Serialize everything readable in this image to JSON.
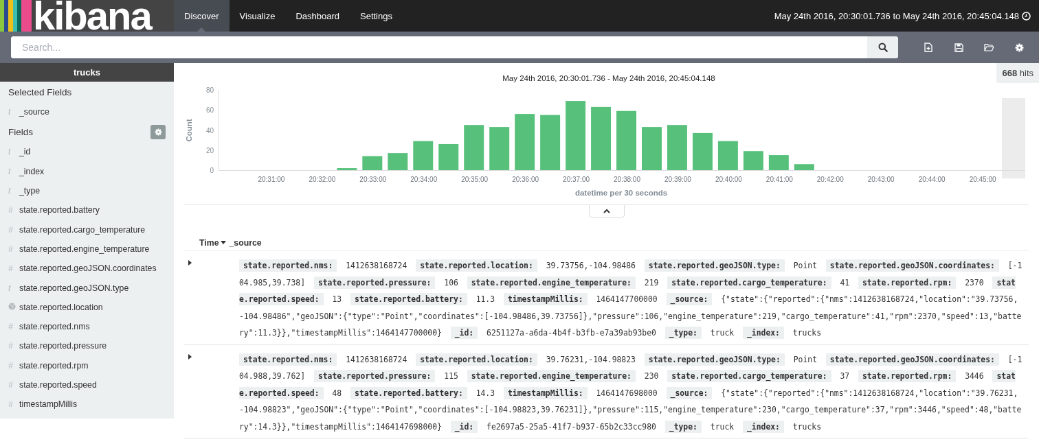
{
  "header": {
    "logo": "kibana",
    "nav": [
      {
        "label": "Discover",
        "selected": true
      },
      {
        "label": "Visualize",
        "selected": false
      },
      {
        "label": "Dashboard",
        "selected": false
      },
      {
        "label": "Settings",
        "selected": false
      }
    ],
    "time_range": "May 24th 2016, 20:30:01.736 to May 24th 2016, 20:45:04.148"
  },
  "search": {
    "placeholder": "Search..."
  },
  "sidebar": {
    "index_pattern": "trucks",
    "selected_title": "Selected Fields",
    "selected_fields": [
      {
        "kind": "text",
        "glyph": "t",
        "name": "_source"
      }
    ],
    "fields_title": "Fields",
    "fields": [
      {
        "kind": "text",
        "glyph": "t",
        "name": "_id"
      },
      {
        "kind": "text",
        "glyph": "t",
        "name": "_index"
      },
      {
        "kind": "text",
        "glyph": "t",
        "name": "_type"
      },
      {
        "kind": "text",
        "glyph": "#",
        "name": "state.reported.battery"
      },
      {
        "kind": "text",
        "glyph": "#",
        "name": "state.reported.cargo_temperature"
      },
      {
        "kind": "text",
        "glyph": "#",
        "name": "state.reported.engine_temperature"
      },
      {
        "kind": "text",
        "glyph": "#",
        "name": "state.reported.geoJSON.coordinates"
      },
      {
        "kind": "text",
        "glyph": "t",
        "name": "state.reported.geoJSON.type"
      },
      {
        "kind": "geo",
        "name": "state.reported.location"
      },
      {
        "kind": "text",
        "glyph": "#",
        "name": "state.reported.nms"
      },
      {
        "kind": "text",
        "glyph": "#",
        "name": "state.reported.pressure"
      },
      {
        "kind": "text",
        "glyph": "#",
        "name": "state.reported.rpm"
      },
      {
        "kind": "text",
        "glyph": "#",
        "name": "state.reported.speed"
      },
      {
        "kind": "text",
        "glyph": "#",
        "name": "timestampMillis"
      }
    ]
  },
  "hits": {
    "count": "668",
    "label": "hits"
  },
  "histogram": {
    "chart_data": {
      "type": "bar",
      "title": "May 24th 2016, 20:30:01.736 - May 24th 2016, 20:45:04.148",
      "xlabel": "datetime per 30 seconds",
      "ylabel": "Count",
      "categories": [
        null,
        null,
        "20:31:00",
        null,
        "20:32:00",
        null,
        "20:33:00",
        null,
        "20:34:00",
        null,
        "20:35:00",
        null,
        "20:36:00",
        null,
        "20:37:00",
        null,
        "20:38:00",
        null,
        "20:39:00",
        null,
        "20:40:00",
        null,
        "20:41:00",
        null,
        "20:42:00",
        null,
        "20:43:00",
        null,
        "20:44:00",
        null,
        "20:45:00"
      ],
      "values": [
        0,
        0,
        0,
        0,
        0,
        2,
        14,
        17,
        29,
        26,
        45,
        43,
        56,
        55,
        69,
        63,
        59,
        43,
        45,
        37,
        29,
        19,
        15,
        6,
        0,
        0,
        0,
        0,
        0,
        0,
        0
      ],
      "ylim": [
        0,
        80
      ],
      "yticks": [
        0,
        20,
        40,
        60,
        80
      ]
    }
  },
  "table": {
    "columns": [
      {
        "label": "Time",
        "sorted": true
      },
      {
        "label": "_source",
        "sorted": false
      }
    ],
    "rows": [
      {
        "fields": [
          {
            "key": "state.reported.nms:",
            "value": "1412638168724"
          },
          {
            "key": "state.reported.location:",
            "value": "39.73756,-104.98486"
          },
          {
            "key": "state.reported.geoJSON.type:",
            "value": "Point"
          },
          {
            "key": "state.reported.geoJSON.coordinates:",
            "value": "[-104.985,39.738]"
          },
          {
            "key": "state.reported.pressure:",
            "value": "106"
          },
          {
            "key": "state.reported.engine_temperature:",
            "value": "219"
          },
          {
            "key": "state.reported.cargo_temperature:",
            "value": "41"
          },
          {
            "key": "state.reported.rpm:",
            "value": "2370"
          },
          {
            "key": "state.reported.speed:",
            "value": "13"
          },
          {
            "key": "state.reported.battery:",
            "value": "11.3"
          },
          {
            "key": "timestampMillis:",
            "value": "1464147700000"
          },
          {
            "key": "_source:",
            "value": "{\"state\":{\"reported\":{\"nms\":1412638168724,\"location\":\"39.73756,-104.98486\",\"geoJSON\":{\"type\":\"Point\",\"coordinates\":[-104.98486,39.73756]},\"pressure\":106,\"engine_temperature\":219,\"cargo_temperature\":41,\"rpm\":2370,\"speed\":13,\"battery\":11.3}},\"timestampMillis\":1464147700000}"
          },
          {
            "key": "_id:",
            "value": "6251127a-a6da-4b4f-b3fb-e7a39ab93be0"
          },
          {
            "key": "_type:",
            "value": "truck"
          },
          {
            "key": "_index:",
            "value": "trucks"
          }
        ]
      },
      {
        "fields": [
          {
            "key": "state.reported.nms:",
            "value": "1412638168724"
          },
          {
            "key": "state.reported.location:",
            "value": "39.76231,-104.98823"
          },
          {
            "key": "state.reported.geoJSON.type:",
            "value": "Point"
          },
          {
            "key": "state.reported.geoJSON.coordinates:",
            "value": "[-104.988,39.762]"
          },
          {
            "key": "state.reported.pressure:",
            "value": "115"
          },
          {
            "key": "state.reported.engine_temperature:",
            "value": "230"
          },
          {
            "key": "state.reported.cargo_temperature:",
            "value": "37"
          },
          {
            "key": "state.reported.rpm:",
            "value": "3446"
          },
          {
            "key": "state.reported.speed:",
            "value": "48"
          },
          {
            "key": "state.reported.battery:",
            "value": "14.3"
          },
          {
            "key": "timestampMillis:",
            "value": "1464147698000"
          },
          {
            "key": "_source:",
            "value": "{\"state\":{\"reported\":{\"nms\":1412638168724,\"location\":\"39.76231,-104.98823\",\"geoJSON\":{\"type\":\"Point\",\"coordinates\":[-104.98823,39.76231]},\"pressure\":115,\"engine_temperature\":230,\"cargo_temperature\":37,\"rpm\":3446,\"speed\":48,\"battery\":14.3}},\"timestampMillis\":1464147698000}"
          },
          {
            "key": "_id:",
            "value": "fe2697a5-25a5-41f7-b937-65b2c33cc980"
          },
          {
            "key": "_type:",
            "value": "truck"
          },
          {
            "key": "_index:",
            "value": "trucks"
          }
        ]
      }
    ]
  }
}
